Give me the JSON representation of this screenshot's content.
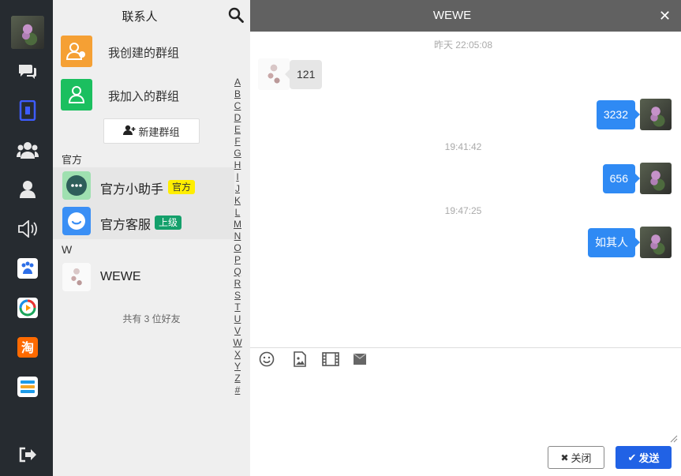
{
  "sidebar": {
    "icons": [
      "chat-icon",
      "contacts-book-icon",
      "group-icon",
      "user-icon",
      "speaker-icon",
      "baidu-app-icon",
      "video-app-icon",
      "taobao-app-icon",
      "layers-app-icon",
      "logout-icon"
    ]
  },
  "contacts": {
    "title": "联系人",
    "groups": [
      {
        "label": "我创建的群组",
        "color": "#f5a034"
      },
      {
        "label": "我加入的群组",
        "color": "#1bbf5f"
      }
    ],
    "new_group_label": "新建群组",
    "sections": [
      {
        "header": "官方",
        "items": [
          {
            "name": "官方小助手",
            "tag": "官方"
          },
          {
            "name": "官方客服",
            "tag": "上级"
          }
        ]
      },
      {
        "header": "W",
        "items": [
          {
            "name": "WEWE"
          }
        ]
      }
    ],
    "friend_count_text": "共有 3 位好友",
    "alphabet": [
      "A",
      "B",
      "C",
      "D",
      "E",
      "F",
      "G",
      "H",
      "I",
      "J",
      "K",
      "L",
      "M",
      "N",
      "O",
      "P",
      "Q",
      "R",
      "S",
      "T",
      "U",
      "V",
      "W",
      "X",
      "Y",
      "Z",
      "#"
    ]
  },
  "chat": {
    "title": "WEWE",
    "messages": [
      {
        "time": "昨天 22:05:08",
        "side": "left",
        "text": "121"
      },
      {
        "side": "right",
        "text": "3232"
      },
      {
        "time": "19:41:42",
        "side": "right",
        "text": "656"
      },
      {
        "time": "19:47:25",
        "side": "right",
        "text": "如其人"
      }
    ],
    "toolbar": [
      "emoji-icon",
      "image-icon",
      "video-icon",
      "file-icon"
    ],
    "close_label": "关闭",
    "send_label": "发送",
    "accent_color": "#2f8af4"
  }
}
